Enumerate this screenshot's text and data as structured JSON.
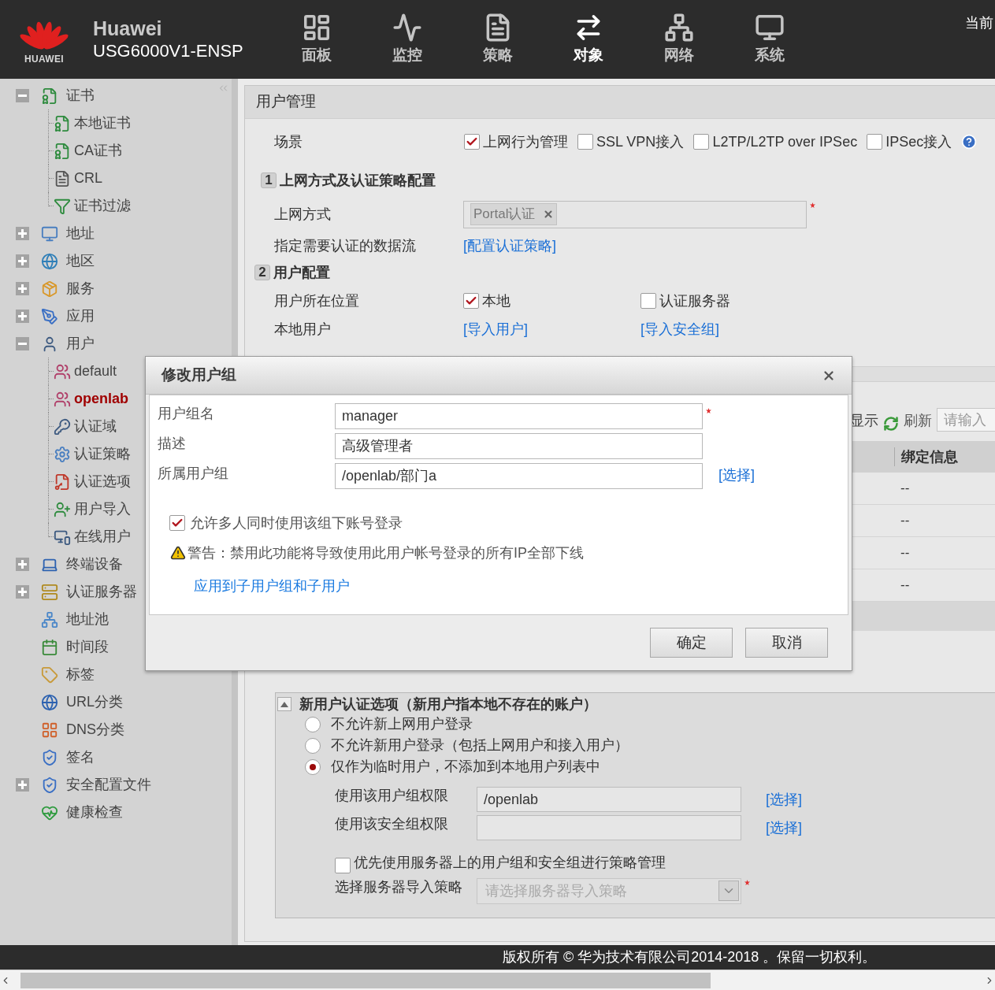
{
  "header": {
    "logo_text": "HUAWEI",
    "brand": "Huawei",
    "model": "USG6000V1-ENSP",
    "nav": [
      {
        "label": "面板",
        "selected": false
      },
      {
        "label": "监控",
        "selected": false
      },
      {
        "label": "策略",
        "selected": false
      },
      {
        "label": "对象",
        "selected": true
      },
      {
        "label": "网络",
        "selected": false
      },
      {
        "label": "系统",
        "selected": false
      }
    ],
    "corner_text": "当前"
  },
  "sidebar": {
    "items": [
      {
        "label": "证书",
        "kind": "group",
        "expanded": true,
        "selected": false,
        "children": [
          {
            "label": "本地证书",
            "selected": false
          },
          {
            "label": "CA证书",
            "selected": false
          },
          {
            "label": "CRL",
            "selected": false
          },
          {
            "label": "证书过滤",
            "selected": false
          }
        ]
      },
      {
        "label": "地址",
        "kind": "group",
        "expanded": false,
        "selected": false
      },
      {
        "label": "地区",
        "kind": "group",
        "expanded": false,
        "selected": false
      },
      {
        "label": "服务",
        "kind": "group",
        "expanded": false,
        "selected": false
      },
      {
        "label": "应用",
        "kind": "group",
        "expanded": false,
        "selected": false
      },
      {
        "label": "用户",
        "kind": "group",
        "expanded": true,
        "selected": false,
        "children": [
          {
            "label": "default",
            "selected": false
          },
          {
            "label": "openlab",
            "selected": true
          },
          {
            "label": "认证域",
            "selected": false
          },
          {
            "label": "认证策略",
            "selected": false
          },
          {
            "label": "认证选项",
            "selected": false
          },
          {
            "label": "用户导入",
            "selected": false
          },
          {
            "label": "在线用户",
            "selected": false
          }
        ]
      },
      {
        "label": "终端设备",
        "kind": "group",
        "expanded": false,
        "selected": false
      },
      {
        "label": "认证服务器",
        "kind": "group",
        "expanded": false,
        "selected": false
      },
      {
        "label": "地址池",
        "kind": "leaf",
        "selected": false
      },
      {
        "label": "时间段",
        "kind": "leaf",
        "selected": false
      },
      {
        "label": "标签",
        "kind": "leaf",
        "selected": false
      },
      {
        "label": "URL分类",
        "kind": "leaf",
        "selected": false
      },
      {
        "label": "DNS分类",
        "kind": "leaf",
        "selected": false
      },
      {
        "label": "签名",
        "kind": "leaf",
        "selected": false
      },
      {
        "label": "安全配置文件",
        "kind": "group",
        "expanded": false,
        "selected": false
      },
      {
        "label": "健康检查",
        "kind": "leaf",
        "selected": false
      }
    ]
  },
  "panel": {
    "title": "用户管理",
    "scenario": {
      "label": "场景",
      "options": [
        {
          "label": "上网行为管理",
          "checked": true
        },
        {
          "label": "SSL VPN接入",
          "checked": false
        },
        {
          "label": "L2TP/L2TP over IPSec",
          "checked": false
        },
        {
          "label": "IPSec接入",
          "checked": false
        }
      ]
    },
    "sections": [
      {
        "number": "1",
        "title": "上网方式及认证策略配置"
      },
      {
        "number": "2",
        "title": "用户配置"
      }
    ],
    "access_mode": {
      "label": "上网方式",
      "tags": [
        "Portal认证"
      ],
      "required": true
    },
    "data_flow": {
      "label": "指定需要认证的数据流",
      "link": "[配置认证策略]"
    },
    "user_location": {
      "label": "用户所在位置",
      "options": [
        {
          "label": "本地",
          "checked": true
        },
        {
          "label": "认证服务器",
          "checked": false
        }
      ]
    },
    "local_user": {
      "label": "本地用户",
      "links": [
        "[导入用户]",
        "[导入安全组]"
      ]
    },
    "toolbar": {
      "display": "显示",
      "refresh": "刷新",
      "search_placeholder": "请输入"
    },
    "table": {
      "columns": [
        "绑定信息"
      ],
      "rows": [
        [
          "--"
        ],
        [
          "--"
        ],
        [
          "--"
        ],
        [
          "--"
        ]
      ]
    },
    "new_user": {
      "title": "新用户认证选项（新用户指本地不存在的账户）",
      "expanded": true,
      "options": [
        {
          "label": "不允许新上网用户登录",
          "selected": false
        },
        {
          "label": "不允许新用户登录（包括上网用户和接入用户）",
          "selected": false
        },
        {
          "label": "仅作为临时用户，不添加到本地用户列表中",
          "selected": true
        }
      ],
      "fields": [
        {
          "label": "使用该用户组权限",
          "value": "/openlab",
          "link": "[选择]"
        },
        {
          "label": "使用该安全组权限",
          "link": "[选择]"
        }
      ],
      "server_pref": {
        "label": "优先使用服务器上的用户组和安全组进行策略管理",
        "checked": false
      },
      "import_policy": {
        "label": "选择服务器导入策略",
        "placeholder": "请选择服务器导入策略",
        "disabled": true,
        "required": true
      }
    }
  },
  "dialog": {
    "title": "修改用户组",
    "fields": [
      {
        "label": "用户组名",
        "value": "manager",
        "required": true
      },
      {
        "label": "描述",
        "value": "高级管理者",
        "required": false
      },
      {
        "label": "所属用户组",
        "value": "/openlab/部门a",
        "required": false,
        "link": "[选择]"
      }
    ],
    "allow_multi": {
      "label": "允许多人同时使用该组下账号登录",
      "checked": true
    },
    "warning": "警告：禁用此功能将导致使用此用户帐号登录的所有IP全部下线",
    "apply_link": "应用到子用户组和子用户",
    "buttons": [
      "确定",
      "取消"
    ]
  },
  "footer": {
    "copyright": "版权所有 © 华为技术有限公司2014-2018 。保留一切权利。"
  }
}
